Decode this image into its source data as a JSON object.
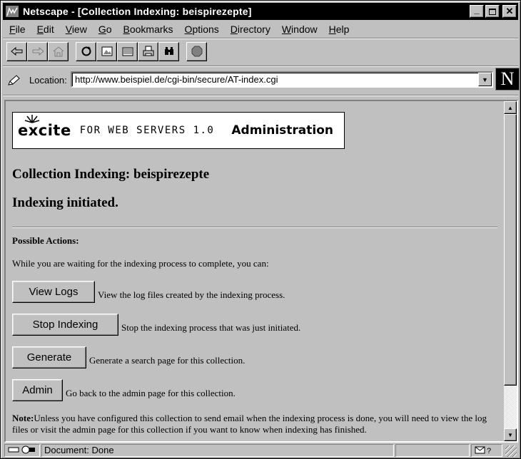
{
  "window": {
    "title": "Netscape - [Collection Indexing: beispirezepte]",
    "minimize_glyph": "_",
    "maximize_glyph": "☐",
    "close_glyph": "✕"
  },
  "menu": {
    "items": [
      {
        "accel": "F",
        "rest": "ile"
      },
      {
        "accel": "E",
        "rest": "dit"
      },
      {
        "accel": "V",
        "rest": "iew"
      },
      {
        "accel": "G",
        "rest": "o"
      },
      {
        "accel": "B",
        "rest": "ookmarks"
      },
      {
        "accel": "O",
        "rest": "ptions"
      },
      {
        "accel": "D",
        "rest": "irectory"
      },
      {
        "accel": "W",
        "rest": "indow"
      },
      {
        "accel": "H",
        "rest": "elp"
      }
    ]
  },
  "toolbar": {
    "icons": [
      "back-icon",
      "forward-icon",
      "home-icon",
      "reload-icon",
      "images-icon",
      "open-icon",
      "print-icon",
      "find-icon",
      "stop-icon"
    ]
  },
  "location": {
    "label": "Location:",
    "url": "http://www.beispiel.de/cgi-bin/secure/AT-index.cgi",
    "logo_letter": "N"
  },
  "page": {
    "banner": {
      "logo": "excite",
      "subtitle": "FOR WEB SERVERS 1.0",
      "admin": "Administration"
    },
    "title": "Collection Indexing: beispirezepte",
    "status": "Indexing initiated.",
    "actions_heading": "Possible Actions:",
    "intro": "While you are waiting for the indexing process to complete, you can:",
    "actions": [
      {
        "label": "View Logs",
        "desc": "View the log files created by the indexing process."
      },
      {
        "label": "Stop Indexing",
        "desc": "Stop the indexing process that was just initiated."
      },
      {
        "label": "Generate",
        "desc": "Generate a search page for this collection."
      },
      {
        "label": "Admin",
        "desc": "Go back to the admin page for this collection."
      }
    ],
    "note_label": "Note:",
    "note_text": "Unless you have configured this collection to send email when the indexing process is done, you will need to view the log files or visit the admin page for this collection if you want to know when indexing has finished."
  },
  "statusbar": {
    "text": "Document: Done"
  }
}
